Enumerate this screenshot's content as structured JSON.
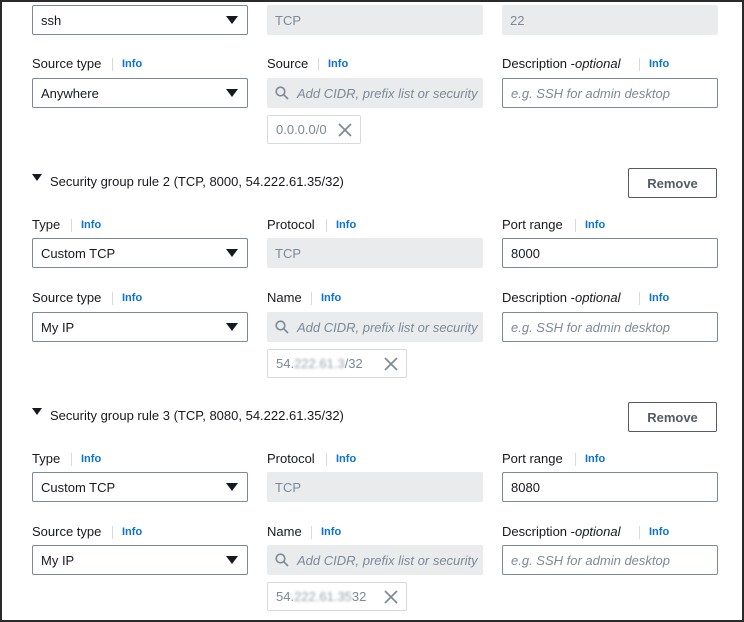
{
  "top": {
    "type_value": "ssh",
    "protocol_value": "TCP",
    "port_value": "22"
  },
  "rule1": {
    "source_type_label": "Source type",
    "source_type_value": "Anywhere",
    "source_label": "Source",
    "source_placeholder": "Add CIDR, prefix list or security",
    "source_token": "0.0.0.0/0",
    "desc_label": "Description - ",
    "desc_optional": "optional",
    "desc_placeholder": "e.g. SSH for admin desktop"
  },
  "rule2": {
    "title": "Security group rule 2 (TCP, 8000, 54.222.61.35/32)",
    "remove_label": "Remove",
    "type_label": "Type",
    "type_value": "Custom TCP",
    "protocol_label": "Protocol",
    "protocol_value": "TCP",
    "port_label": "Port range",
    "port_value": "8000",
    "source_type_label": "Source type",
    "source_type_value": "My IP",
    "name_label": "Name",
    "source_placeholder": "Add CIDR, prefix list or security",
    "token_prefix": "54.",
    "token_masked": "222.61.3",
    "token_suffix": "/32",
    "desc_label": "Description - ",
    "desc_optional": "optional",
    "desc_placeholder": "e.g. SSH for admin desktop"
  },
  "rule3": {
    "title": "Security group rule 3 (TCP, 8080, 54.222.61.35/32)",
    "remove_label": "Remove",
    "type_label": "Type",
    "type_value": "Custom TCP",
    "protocol_label": "Protocol",
    "protocol_value": "TCP",
    "port_label": "Port range",
    "port_value": "8080",
    "source_type_label": "Source type",
    "source_type_value": "My IP",
    "name_label": "Name",
    "source_placeholder": "Add CIDR, prefix list or security",
    "token_prefix": "54.",
    "token_masked": "222.61.35",
    "token_suffix": "32",
    "desc_label": "Description - ",
    "desc_optional": "optional",
    "desc_placeholder": "e.g. SSH for admin desktop"
  },
  "info_label": "Info",
  "colors": {
    "link": "#0972d3",
    "disabled_bg": "#e9ebed",
    "border": "#7d8998"
  }
}
